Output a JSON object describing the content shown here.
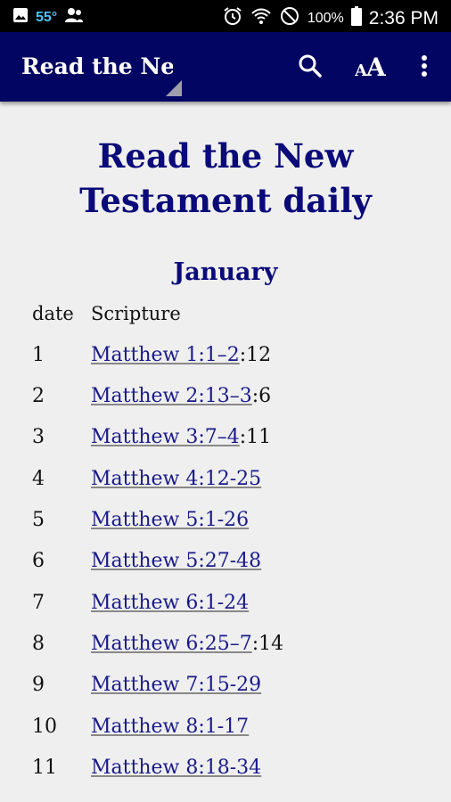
{
  "status_bar": {
    "temperature": "55°",
    "battery": "100%",
    "time": "2:36 PM"
  },
  "app_bar": {
    "title": "Read the Ne"
  },
  "page": {
    "title_line1": "Read the New",
    "title_line2": "Testament daily",
    "month": "January",
    "col_date": "date",
    "col_scripture": "Scripture"
  },
  "readings": [
    {
      "date": "1",
      "link": "Matthew 1:1–2",
      "rest": ":12"
    },
    {
      "date": "2",
      "link": "Matthew 2:13–3",
      "rest": ":6"
    },
    {
      "date": "3",
      "link": "Matthew 3:7–4",
      "rest": ":11"
    },
    {
      "date": "4",
      "link": "Matthew 4:12-25",
      "rest": ""
    },
    {
      "date": "5",
      "link": "Matthew 5:1-26",
      "rest": ""
    },
    {
      "date": "6",
      "link": "Matthew 5:27-48",
      "rest": ""
    },
    {
      "date": "7",
      "link": "Matthew 6:1-24",
      "rest": ""
    },
    {
      "date": "8",
      "link": "Matthew 6:25–7",
      "rest": ":14"
    },
    {
      "date": "9",
      "link": "Matthew 7:15-29",
      "rest": ""
    },
    {
      "date": "10",
      "link": "Matthew 8:1-17",
      "rest": ""
    },
    {
      "date": "11",
      "link": "Matthew 8:18-34",
      "rest": ""
    }
  ]
}
